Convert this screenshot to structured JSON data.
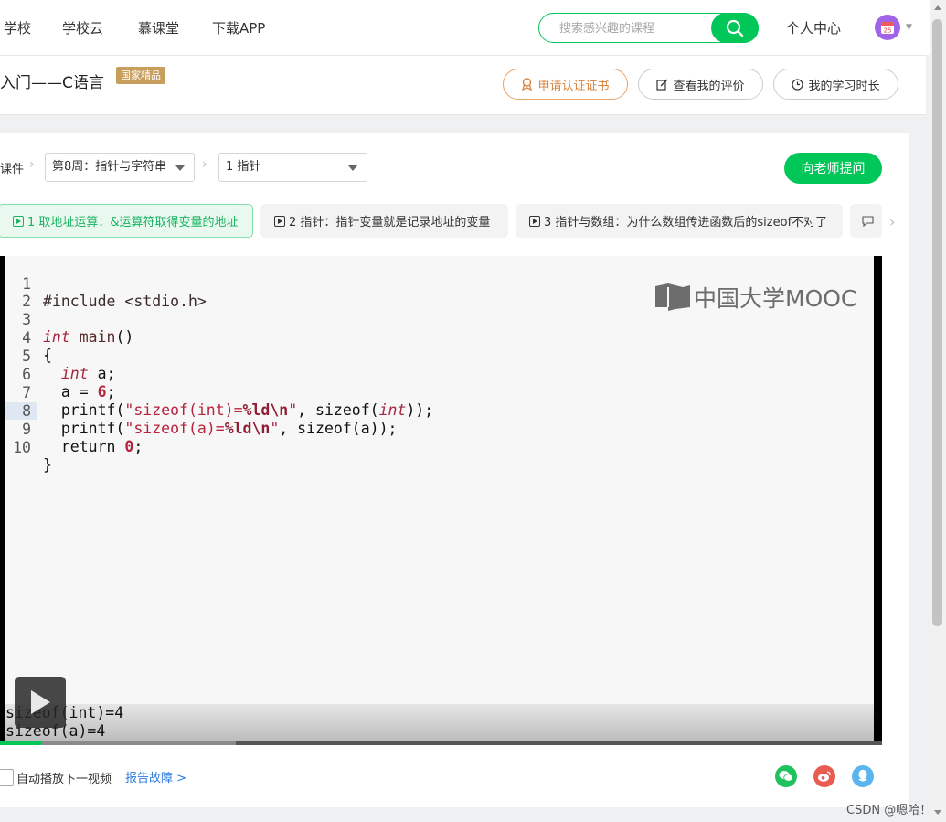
{
  "nav": {
    "items": [
      "学校",
      "学校云",
      "慕课堂",
      "下载APP"
    ],
    "search_placeholder": "搜索感兴趣的课程",
    "personal_center": "个人中心",
    "avatar_text": "25"
  },
  "course": {
    "title": "入门——C语言",
    "badge": "国家精品",
    "buttons": {
      "certificate": "申请认证证书",
      "my_review": "查看我的评价",
      "study_time": "我的学习时长"
    }
  },
  "breadcrumb": {
    "label": "课件",
    "week_select": "第8周：指针与字符串",
    "lesson_select": "1 指针"
  },
  "ask_teacher": "向老师提问",
  "lesson_tabs": [
    "1 取地址运算：&运算符取得变量的地址",
    "2 指针：指针变量就是记录地址的变量",
    "3 指针与数组：为什么数组传进函数后的sizeof不对了"
  ],
  "video": {
    "watermark": "中国大学MOOC",
    "code_lines": [
      "#include <stdio.h>",
      "",
      "int main()",
      "{",
      "  int a;",
      "  a = 6;",
      "  printf(\"sizeof(int)=%ld\\n\", sizeof(int));",
      "  printf(\"sizeof(a)=%ld\\n\", sizeof(a));",
      "  return 0;",
      "}"
    ],
    "line_numbers": [
      "1",
      "2",
      "3",
      "4",
      "5",
      "6",
      "7",
      "8",
      "9",
      "10"
    ],
    "highlighted_line": 8,
    "output": [
      "sizeof(int)=4",
      "sizeof(a)=4"
    ],
    "progress_played": 0.047,
    "progress_buffered": 0.267
  },
  "bottom": {
    "autoplay_label": "自动播放下一视频",
    "report_link": "报告故障 >"
  },
  "share_icons": [
    "wechat-icon",
    "weibo-icon",
    "qq-icon"
  ],
  "colors": {
    "brand_green": "#00c758",
    "badge_gold": "#c89e5c",
    "certificate_orange": "#d9853f",
    "link_blue": "#2b7be0"
  },
  "csdn_mark": "CSDN @嗯哈！"
}
